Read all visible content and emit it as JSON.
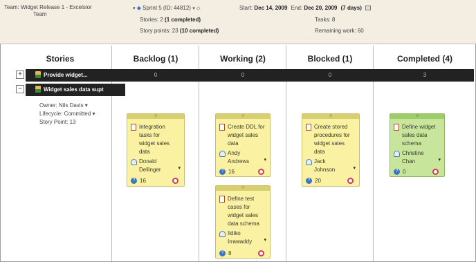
{
  "header": {
    "team": "Team:  Widget Release 1 - Excelsior",
    "team_line2": "Team",
    "sprint": "Sprint 5 (ID: 44812)",
    "start_label": "Start:",
    "start_date": "Dec 14, 2009",
    "end_label": "End:",
    "end_date": "Dec 20, 2009",
    "duration": "(7 days)",
    "stories_label": "Stories: 2",
    "stories_completed": "(1 completed)",
    "points_label": "Story points: 23",
    "points_completed": "(10 completed)",
    "tasks": "Tasks: 8",
    "remaining": "Remaining work: 60"
  },
  "columns": [
    {
      "title": "Stories"
    },
    {
      "title": "Backlog (1)"
    },
    {
      "title": "Working (2)"
    },
    {
      "title": "Blocked (1)"
    },
    {
      "title": "Completed (4)"
    }
  ],
  "stories": [
    {
      "toggle": "+",
      "name": "Provide widget...",
      "counts": [
        "0",
        "0",
        "0",
        "3"
      ]
    },
    {
      "toggle": "−",
      "name": "Widget sales data supt"
    }
  ],
  "story_meta": {
    "owner": "Owner:  Nils Davis ▾",
    "lifecycle": "Lifecycle:  Committed ▾",
    "story_point": "Story Point:  13"
  },
  "cards": [
    {
      "title": [
        "Integration",
        "tasks for",
        "widget sales",
        "data"
      ],
      "owner": [
        "Donald",
        "Dellinger"
      ],
      "points": "16",
      "color": "#faf1a3"
    },
    {
      "title": [
        "Create DDL for",
        "widget sales",
        "data"
      ],
      "owner": [
        "Andy",
        "Andrews"
      ],
      "points": "16",
      "color": "#faf1a3"
    },
    {
      "title": [
        "Define test",
        "cases for",
        "widget sales",
        "data schema"
      ],
      "owner": [
        "Ildiko",
        "Irrawaddy"
      ],
      "points": "8",
      "color": "#faf1a3"
    },
    {
      "title": [
        "Create stored",
        "procedures for",
        "widget sales",
        "data"
      ],
      "owner": [
        "Jack",
        "Johnson"
      ],
      "points": "20",
      "color": "#faf1a3"
    },
    {
      "title": [
        "Define widget",
        "sales data",
        "schema"
      ],
      "owner": [
        "Christine",
        "Chan"
      ],
      "points": "0",
      "color": "#c8e69b"
    }
  ]
}
